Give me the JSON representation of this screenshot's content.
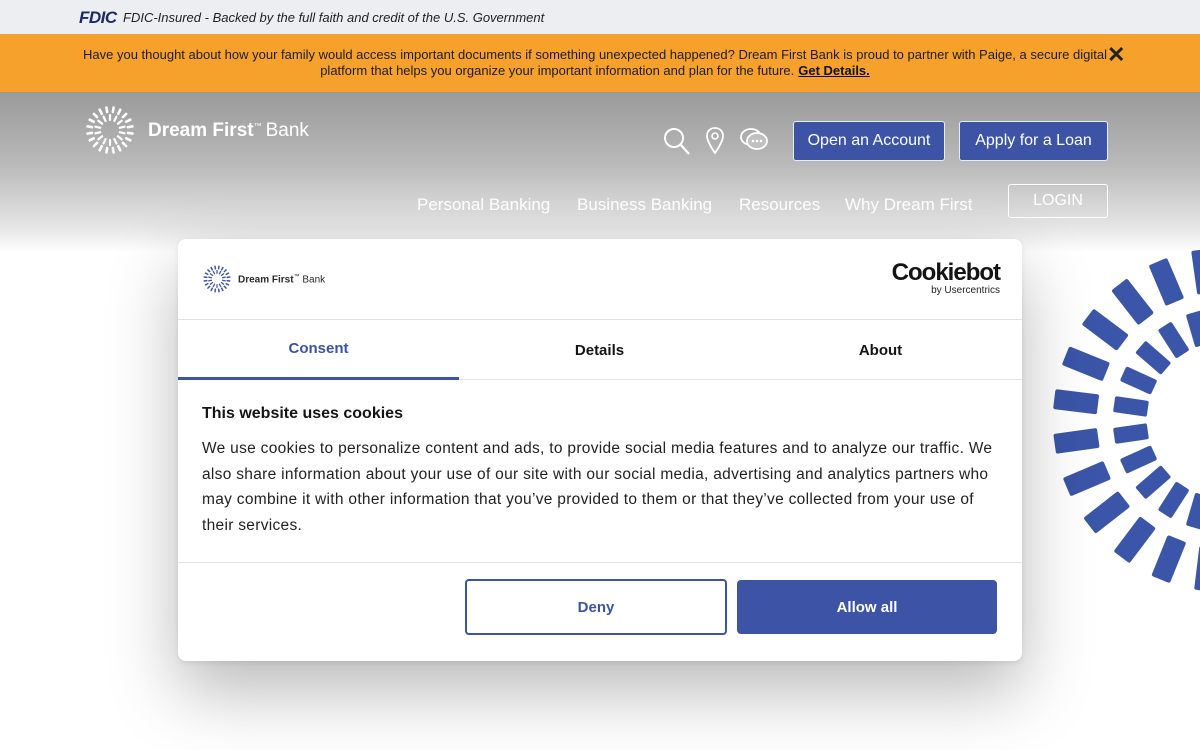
{
  "fdic": {
    "logo": "FDIC",
    "text": "FDIC-Insured - Backed by the full faith and credit of the U.S. Government"
  },
  "announcement": {
    "text": "Have you thought about how your family would access important documents if something unexpected happened? Dream First Bank is proud to partner with Paige, a secure digital platform that helps you organize your important information and plan for the future.",
    "link": "Get Details.",
    "close": "✕"
  },
  "header": {
    "brand_first": "Dream First",
    "brand_tm": "™",
    "brand_second": "Bank",
    "icons": [
      "search-icon",
      "location-pin-icon",
      "chat-icon"
    ],
    "open_account": "Open an Account",
    "apply_loan": "Apply for a Loan",
    "nav": [
      "Personal Banking",
      "Business Banking",
      "Resources",
      "Why Dream First"
    ],
    "login": "LOGIN"
  },
  "colors": {
    "accent": "#3c53a6",
    "announce_bg": "#f6a12c",
    "burst": "#3b55a8"
  },
  "dialog": {
    "logo_first": "Dream First",
    "logo_tm": "™",
    "logo_second": "Bank",
    "cookiebot": "Cookiebot",
    "cookiebot_sub": "by Usercentrics",
    "tabs": [
      "Consent",
      "Details",
      "About"
    ],
    "active_tab": "Consent",
    "heading": "This website uses cookies",
    "body": "We use cookies to personalize content and ads, to provide social media features and to analyze our traffic. We also share information about your use of our site with our social media, advertising and analytics partners who may combine it with other information that you’ve provided to them or that they’ve collected from your use of their services.",
    "deny": "Deny",
    "allow_all": "Allow all"
  }
}
